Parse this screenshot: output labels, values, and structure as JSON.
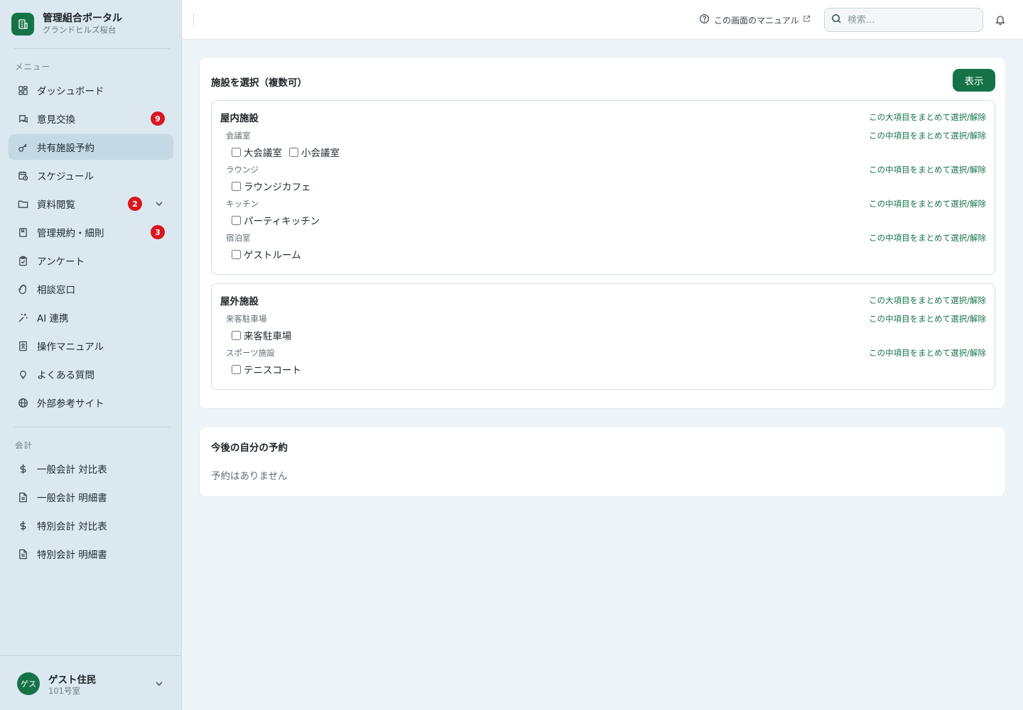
{
  "brand": {
    "title": "管理組合ポータル",
    "subtitle": "グランドヒルズ桜台"
  },
  "sidebar": {
    "menu_label": "メニュー",
    "items": [
      {
        "label": "ダッシュボード",
        "icon": "dashboard-icon"
      },
      {
        "label": "意見交換",
        "icon": "chat-icon",
        "badge": "9"
      },
      {
        "label": "共有施設予約",
        "icon": "key-icon",
        "active": true
      },
      {
        "label": "スケジュール",
        "icon": "calendar-icon"
      },
      {
        "label": "資料閲覧",
        "icon": "folder-icon",
        "badge": "2",
        "expandable": true
      },
      {
        "label": "管理規約・細則",
        "icon": "book-icon",
        "badge": "3"
      },
      {
        "label": "アンケート",
        "icon": "clipboard-icon"
      },
      {
        "label": "相談窓口",
        "icon": "hand-icon"
      },
      {
        "label": "AI 連携",
        "icon": "sparkle-icon"
      },
      {
        "label": "操作マニュアル",
        "icon": "manual-icon"
      },
      {
        "label": "よくある質問",
        "icon": "lightbulb-icon"
      },
      {
        "label": "外部参考サイト",
        "icon": "globe-icon"
      }
    ],
    "accounting_label": "会計",
    "accounting_items": [
      {
        "label": "一般会計 対比表",
        "icon": "dollar-icon"
      },
      {
        "label": "一般会計 明細書",
        "icon": "document-icon"
      },
      {
        "label": "特別会計 対比表",
        "icon": "dollar-icon"
      },
      {
        "label": "特別会計 明細書",
        "icon": "document-icon"
      }
    ]
  },
  "user": {
    "avatar": "ゲス",
    "name": "ゲスト住民",
    "room": "101号室"
  },
  "topbar": {
    "manual_link": "この画面のマニュアル",
    "search_placeholder": "検索..."
  },
  "facility_card": {
    "title": "施設を選択（複数可）",
    "show_button": "表示",
    "bulk_major": "この大項目をまとめて選択/解除",
    "bulk_middle": "この中項目をまとめて選択/解除",
    "groups": [
      {
        "title": "屋内施設",
        "subgroups": [
          {
            "label": "会議室",
            "items": [
              "大会議室",
              "小会議室"
            ]
          },
          {
            "label": "ラウンジ",
            "items": [
              "ラウンジカフェ"
            ]
          },
          {
            "label": "キッチン",
            "items": [
              "パーティキッチン"
            ]
          },
          {
            "label": "宿泊室",
            "items": [
              "ゲストルーム"
            ]
          }
        ]
      },
      {
        "title": "屋外施設",
        "subgroups": [
          {
            "label": "来客駐車場",
            "items": [
              "来客駐車場"
            ]
          },
          {
            "label": "スポーツ施設",
            "items": [
              "テニスコート"
            ]
          }
        ]
      }
    ]
  },
  "reservations_card": {
    "title": "今後の自分の予約",
    "empty": "予約はありません"
  },
  "colors": {
    "accent": "#157347",
    "badge": "#d9171f",
    "sidebar_bg": "#dbe8ef",
    "active_bg": "#c5d9e4"
  }
}
